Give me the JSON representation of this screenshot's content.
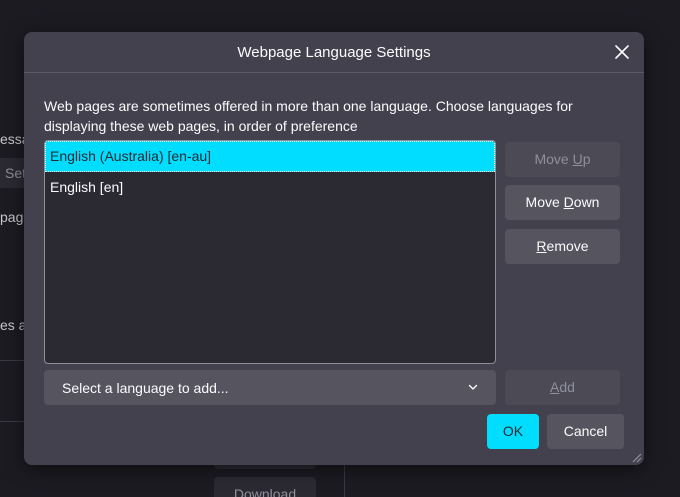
{
  "background": {
    "fragments": [
      "essa",
      "Set",
      "page",
      "es a"
    ],
    "download_button": "Download"
  },
  "dialog": {
    "title": "Webpage Language Settings",
    "close_icon": "close-icon",
    "description": "Web pages are sometimes offered in more than one language. Choose languages for displaying these web pages, in order of preference",
    "languages": [
      {
        "label": "English (Australia) [en-au]",
        "selected": true
      },
      {
        "label": "English [en]",
        "selected": false
      }
    ],
    "buttons": {
      "move_up": {
        "pre": "Move ",
        "key": "U",
        "post": "p",
        "disabled": true
      },
      "move_down": {
        "pre": "Move ",
        "key": "D",
        "post": "own",
        "disabled": false
      },
      "remove": {
        "pre": "",
        "key": "R",
        "post": "emove",
        "disabled": false
      },
      "add": {
        "pre": "",
        "key": "A",
        "post": "dd",
        "disabled": true
      },
      "ok": "OK",
      "cancel": "Cancel"
    },
    "select": {
      "value": "Select a language to add...",
      "icon": "chevron-down-icon"
    }
  },
  "colors": {
    "accent": "#00ddff",
    "dialog_bg": "#42414d",
    "page_bg": "#1c1b22",
    "list_bg": "#2b2a33",
    "button_bg": "#55545f"
  }
}
